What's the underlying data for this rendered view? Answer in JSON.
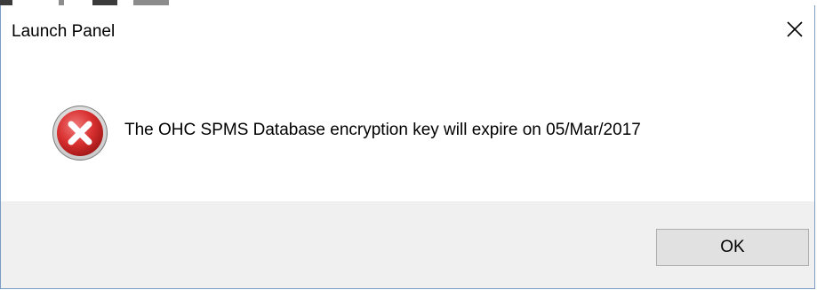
{
  "window": {
    "title": "Launch Panel",
    "close_icon": "close-icon"
  },
  "message": {
    "icon": "error-icon",
    "text": "The OHC SPMS Database encryption key will expire on 05/Mar/2017"
  },
  "buttons": {
    "ok_label": "OK"
  },
  "colors": {
    "error_red": "#d93030",
    "button_face": "#e1e1e1",
    "footer_bg": "#f0f0f0",
    "window_border": "#7a9cc6"
  }
}
